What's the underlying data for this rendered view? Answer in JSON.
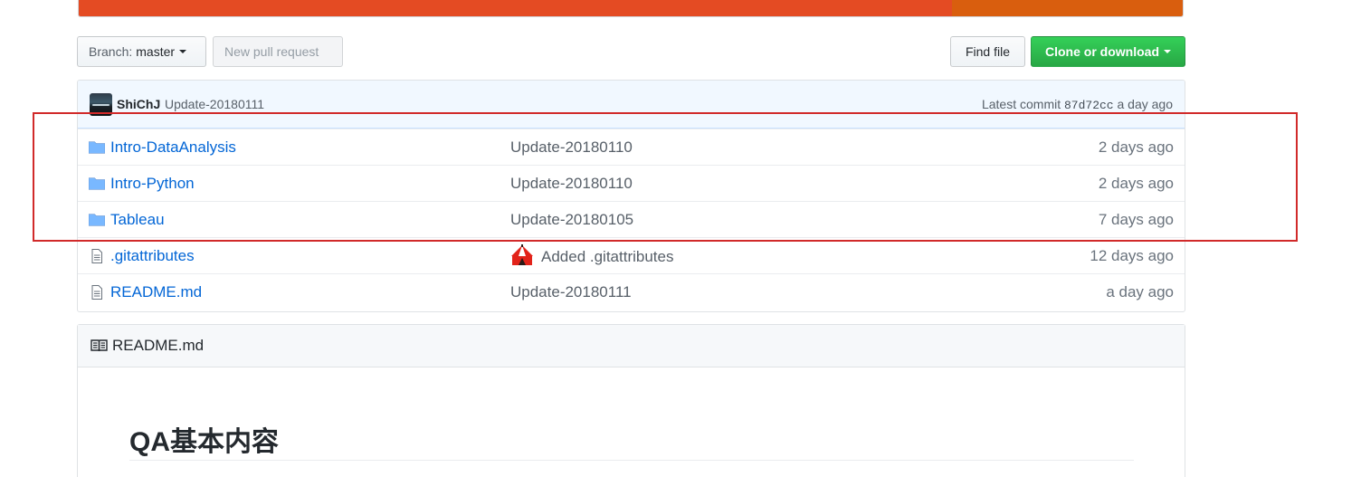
{
  "language_bar": {
    "segments": [
      {
        "color": "#e44b23",
        "share": 0.791
      },
      {
        "color": "#d95e0e",
        "share": 0.209
      }
    ]
  },
  "toolbar": {
    "branch_prefix": "Branch:",
    "branch_name": "master",
    "new_pr_label": "New pull request",
    "find_file_label": "Find file",
    "clone_label": "Clone or download"
  },
  "latest_commit": {
    "author": "ShiChJ",
    "message": "Update-20180111",
    "prefix": "Latest commit",
    "sha": "87d72cc",
    "age": "a day ago"
  },
  "files": [
    {
      "type": "folder",
      "icon": "folder-icon",
      "name": "Intro-DataAnalysis",
      "message": "Update-20180110",
      "age": "2 days ago"
    },
    {
      "type": "folder",
      "icon": "folder-icon",
      "name": "Intro-Python",
      "message": "Update-20180110",
      "age": "2 days ago"
    },
    {
      "type": "folder",
      "icon": "folder-icon",
      "name": "Tableau",
      "message": "Update-20180105",
      "age": "7 days ago"
    },
    {
      "type": "file",
      "icon": "file-icon",
      "name": ".gitattributes",
      "message": "Added .gitattributes",
      "age": "12 days ago",
      "message_emoji": "circus-tent-icon"
    },
    {
      "type": "file",
      "icon": "file-icon",
      "name": "README.md",
      "message": "Update-20180111",
      "age": "a day ago"
    }
  ],
  "readme": {
    "header_title": "README.md",
    "heading": "QA基本内容"
  },
  "colors": {
    "link": "#0366d6",
    "clone_green": "#28a745",
    "highlight": "#d12a2a",
    "folder": "#79b8ff"
  }
}
